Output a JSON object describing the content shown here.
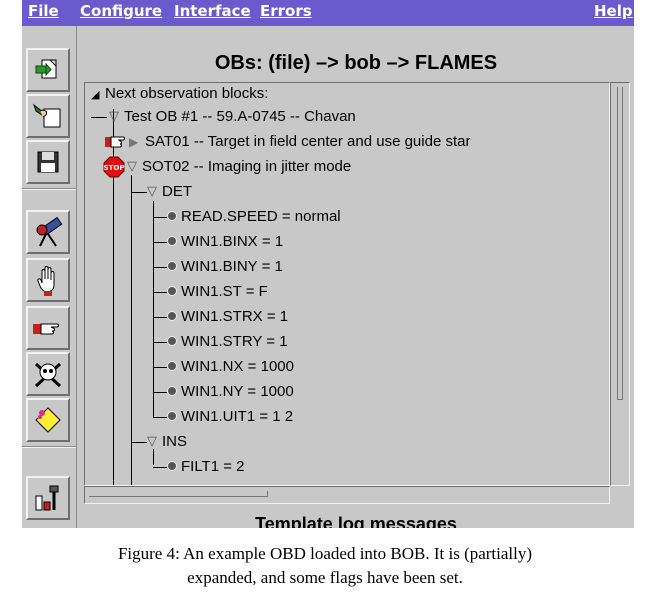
{
  "menubar": {
    "file": "File",
    "configure": "Configure",
    "interface": "Interface",
    "errors": "Errors",
    "help": "Help"
  },
  "panel": {
    "title": "OBs: (file) –> bob –> FLAMES",
    "log_title": "Template log  messages"
  },
  "tree": {
    "root": "Next observation blocks:",
    "ob": "Test OB #1 -- 59.A-0745 -- Chavan",
    "sat01": "SAT01 -- Target in field center and use guide star",
    "sot02": "SOT02 -- Imaging in jitter mode",
    "det": "DET",
    "det_items": [
      "READ.SPEED = normal",
      "WIN1.BINX = 1",
      "WIN1.BINY = 1",
      "WIN1.ST = F",
      "WIN1.STRX = 1",
      "WIN1.STRY = 1",
      "WIN1.NX = 1000",
      "WIN1.NY = 1000",
      "WIN1.UIT1 = 1 2"
    ],
    "ins": "INS",
    "ins_items": [
      "FILT1 = 2"
    ],
    "stop_label": "STOP"
  },
  "toolbar_icons": [
    "load-obd-icon",
    "hand-paper-icon",
    "save-disk-icon",
    "telescope-icon",
    "raised-hand-icon",
    "pointing-hand-icon",
    "skull-crossbones-icon",
    "sticky-note-icon",
    "tools-icon"
  ],
  "colors": {
    "menubar": "#6a5acd",
    "panel": "#c8c8c8",
    "stop": "#e01010"
  },
  "caption": {
    "line1": "Figure 4: An example OBD loaded into BOB.  It is (partially)",
    "line2": "expanded, and some flags have been set."
  }
}
